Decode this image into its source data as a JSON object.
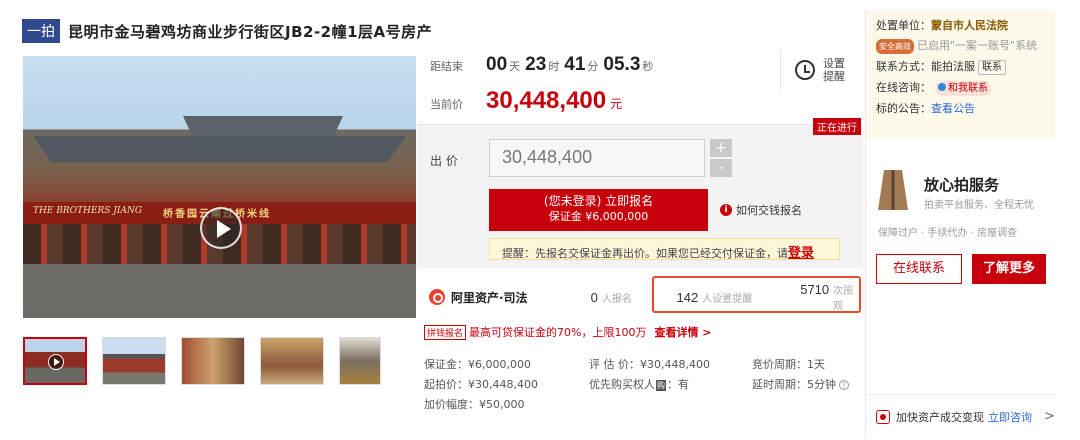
{
  "title": {
    "tag": "一拍",
    "text": "昆明市金马碧鸡坊商业步行街区JB2-2幢1层A号房产"
  },
  "photo": {
    "sign_en": "THE BROTHERS JIANG",
    "sign_cn": "桥香园云南过桥米线"
  },
  "countdown": {
    "label": "距结束",
    "days": "00",
    "days_unit": "天",
    "hours": "23",
    "hours_unit": "时",
    "minutes": "41",
    "minutes_unit": "分",
    "seconds": "05.3",
    "seconds_unit": "秒"
  },
  "remind": {
    "text": "设置提醒"
  },
  "current_price": {
    "label": "当前价",
    "value": "30,448,400",
    "unit": "元"
  },
  "status": "正在进行",
  "bid": {
    "label": "出 价",
    "value": "30,448,400",
    "plus": "+",
    "minus": "-",
    "register_l1": "(您未登录) 立即报名",
    "register_l2": "保证金 ¥6,000,000",
    "how_pay": "如何交钱报名",
    "tip": "提醒：先报名交保证金再出价。如果您已经交付保证金，请",
    "tip_login": "登录"
  },
  "stats": {
    "brand": "阿里资产·司法",
    "signups_num": "0",
    "signups_unit": "人报名",
    "reminders_num": "142",
    "reminders_unit": "人设置提醒",
    "views_num": "5710",
    "views_unit": "次围观"
  },
  "promo": {
    "tag": "拼钱报名",
    "text": "最高可贷保证金的70%，上限100万",
    "link": "查看详情 >"
  },
  "info": [
    [
      "保证金：¥6,000,000",
      "评 估 价：¥30,448,400",
      "竞价周期：1天"
    ],
    [
      "起拍价：¥30,448,400",
      "优先购买权人",
      "延时周期：5分钟"
    ],
    [
      "加价幅度：¥50,000",
      "",
      ""
    ]
  ],
  "info_extra": {
    "priority_badge": "购",
    "priority_value": "：有",
    "q": "?"
  },
  "right": {
    "unit_label": "处置单位：",
    "unit_value": "蒙自市人民法院",
    "badge": "安全高效",
    "badge_text": "已启用\"一案一账号\"系统",
    "contact_label": "联系方式：",
    "contact_value": "能拍法服",
    "contact_btn": "联系",
    "consult_label": "在线咨询：",
    "consult_pill": "和我联系",
    "notice_label": "标的公告：",
    "notice_link": "查看公告",
    "svc_title": "放心拍服务",
    "svc_sub": "拍卖平台服务、全程无忧",
    "svc_tags": "保障过户 · 手续代办 · 房屋调查",
    "btn_online": "在线联系",
    "btn_more": "了解更多",
    "bottom_text": "加快资产成交变现",
    "bottom_link": "立即咨询",
    "bottom_arrow": ">"
  }
}
